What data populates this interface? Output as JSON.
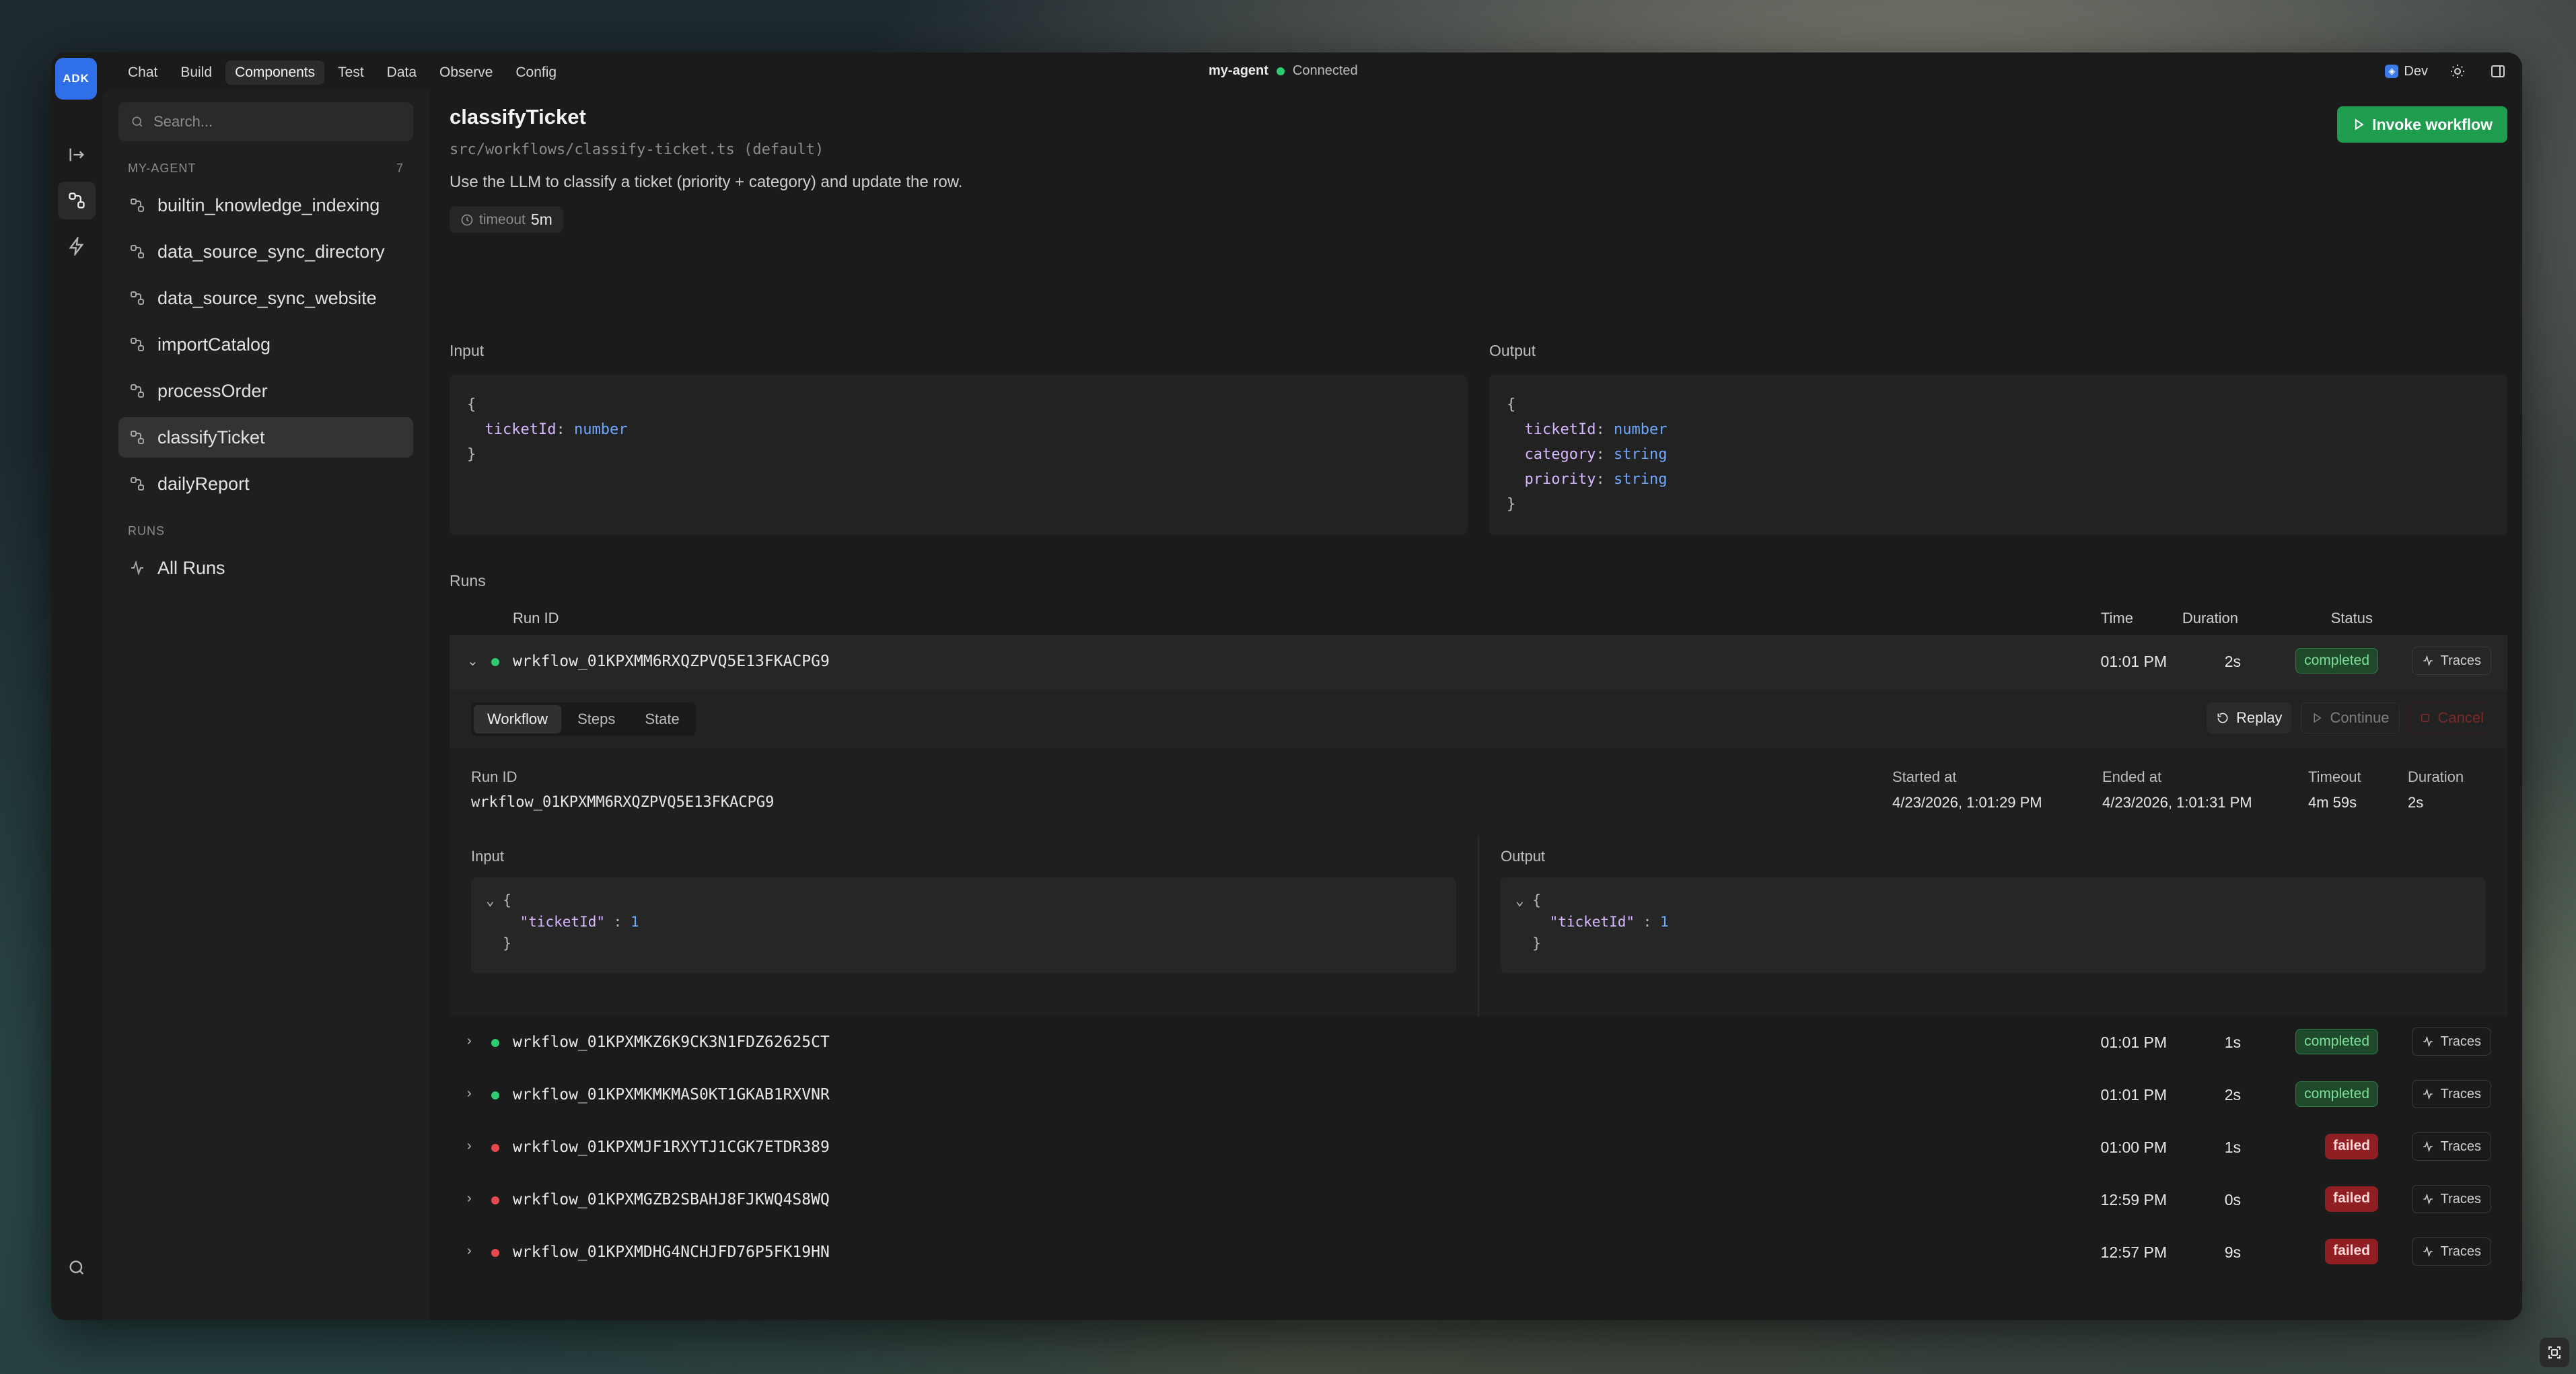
{
  "app": {
    "logo": "ADK"
  },
  "nav": [
    "Chat",
    "Build",
    "Components",
    "Test",
    "Data",
    "Observe",
    "Config"
  ],
  "nav_active": "Components",
  "status": {
    "agent": "my-agent",
    "state": "Connected"
  },
  "env": {
    "label": "Dev"
  },
  "sidebar": {
    "search_placeholder": "Search...",
    "section": "MY-AGENT",
    "count": "7",
    "items": [
      "builtin_knowledge_indexing",
      "data_source_sync_directory",
      "data_source_sync_website",
      "importCatalog",
      "processOrder",
      "classifyTicket",
      "dailyReport"
    ],
    "active": "classifyTicket",
    "runs_section": "RUNS",
    "all_runs": "All Runs"
  },
  "workflow": {
    "name": "classifyTicket",
    "path": "src/workflows/classify-ticket.ts (default)",
    "description": "Use the LLM to classify a ticket (priority + category) and update the row.",
    "timeout_label": "timeout",
    "timeout_value": "5m",
    "invoke_label": "Invoke workflow"
  },
  "schema": {
    "input_label": "Input",
    "output_label": "Output",
    "input_fields": [
      {
        "key": "ticketId",
        "type": "number"
      }
    ],
    "output_fields": [
      {
        "key": "ticketId",
        "type": "number"
      },
      {
        "key": "category",
        "type": "string"
      },
      {
        "key": "priority",
        "type": "string"
      }
    ]
  },
  "runs": {
    "label": "Runs",
    "headers": {
      "id": "Run ID",
      "time": "Time",
      "duration": "Duration",
      "status": "Status"
    },
    "traces_label": "Traces",
    "rows": [
      {
        "id": "wrkflow_01KPXMM6RXQZPVQ5E13FKACPG9",
        "time": "01:01 PM",
        "duration": "2s",
        "status": "completed",
        "expanded": true
      },
      {
        "id": "wrkflow_01KPXMKZ6K9CK3N1FDZ62625CT",
        "time": "01:01 PM",
        "duration": "1s",
        "status": "completed"
      },
      {
        "id": "wrkflow_01KPXMKMKMAS0KT1GKAB1RXVNR",
        "time": "01:01 PM",
        "duration": "2s",
        "status": "completed"
      },
      {
        "id": "wrkflow_01KPXMJF1RXYTJ1CGK7ETDR389",
        "time": "01:00 PM",
        "duration": "1s",
        "status": "failed"
      },
      {
        "id": "wrkflow_01KPXMGZB2SBAHJ8FJKWQ4S8WQ",
        "time": "12:59 PM",
        "duration": "0s",
        "status": "failed"
      },
      {
        "id": "wrkflow_01KPXMDHG4NCHJFD76P5FK19HN",
        "time": "12:57 PM",
        "duration": "9s",
        "status": "failed"
      }
    ]
  },
  "detail": {
    "tabs": [
      "Workflow",
      "Steps",
      "State"
    ],
    "active_tab": "Workflow",
    "actions": {
      "replay": "Replay",
      "continue": "Continue",
      "cancel": "Cancel"
    },
    "meta": {
      "run_id_label": "Run ID",
      "run_id": "wrkflow_01KPXMM6RXQZPVQ5E13FKACPG9",
      "started_label": "Started at",
      "started": "4/23/2026, 1:01:29 PM",
      "ended_label": "Ended at",
      "ended": "4/23/2026, 1:01:31 PM",
      "timeout_label": "Timeout",
      "timeout": "4m 59s",
      "duration_label": "Duration",
      "duration": "2s"
    },
    "input_label": "Input",
    "output_label": "Output",
    "input_key": "\"ticketId\"",
    "input_value": "1",
    "output_key": "\"ticketId\"",
    "output_value": "1"
  },
  "colors": {
    "accent": "#1f9d4f",
    "completed": "#7ddf98",
    "failed": "#8f1f22",
    "brand": "#2f6fe8"
  }
}
